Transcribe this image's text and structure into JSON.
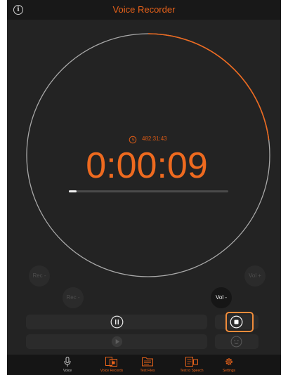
{
  "header": {
    "title": "Voice Recorder",
    "info_icon": "info-icon"
  },
  "recorder": {
    "remaining_time": "482:31:43",
    "elapsed_time": "0:00:09",
    "progress_fraction": 0.05,
    "ring_arc_fraction": 0.23,
    "accent_color": "#ee6a1f"
  },
  "controls": {
    "rec_minus_primary": "Rec -",
    "rec_minus_secondary": "Rec -",
    "vol_minus": "Vol -",
    "vol_plus": "Vol +",
    "pause_icon": "pause-icon",
    "stop_icon": "stop-icon",
    "play_icon": "play-icon",
    "face_icon": "face-icon"
  },
  "tabs": [
    {
      "label": "Voice",
      "icon": "microphone-icon",
      "color": "#bdbdbd"
    },
    {
      "label": "Voice Records",
      "icon": "records-icon",
      "color": "#e8621a"
    },
    {
      "label": "Text Files",
      "icon": "text-files-icon",
      "color": "#e8621a"
    },
    {
      "label": "Text to Speech",
      "icon": "text-to-speech-icon",
      "color": "#e8621a"
    },
    {
      "label": "Settings",
      "icon": "gear-icon",
      "color": "#e8621a"
    }
  ]
}
